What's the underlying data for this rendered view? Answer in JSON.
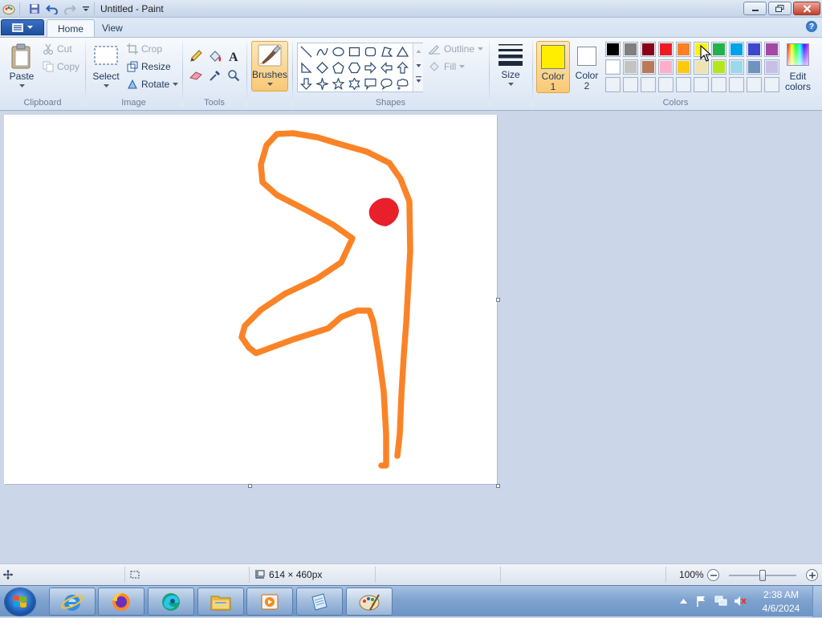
{
  "window": {
    "title": "Untitled - Paint"
  },
  "tabs": [
    {
      "label": "Home"
    },
    {
      "label": "View"
    }
  ],
  "ribbon": {
    "clipboard": {
      "group_label": "Clipboard",
      "paste": "Paste",
      "cut": "Cut",
      "copy": "Copy"
    },
    "image": {
      "group_label": "Image",
      "select": "Select",
      "crop": "Crop",
      "resize": "Resize",
      "rotate": "Rotate"
    },
    "tools": {
      "group_label": "Tools"
    },
    "brushes": {
      "label": "Brushes"
    },
    "shapes": {
      "group_label": "Shapes",
      "outline": "Outline",
      "fill": "Fill"
    },
    "size": {
      "label": "Size"
    },
    "colors": {
      "group_label": "Colors",
      "color1_label": "Color 1",
      "color1_line1": "Color",
      "color1_line2": "1",
      "color1_value": "#ffee00",
      "color2_line1": "Color",
      "color2_line2": "2",
      "color2_value": "#ffffff",
      "edit_line1": "Edit",
      "edit_line2": "colors",
      "palette_row1": [
        "#000000",
        "#7f7f7f",
        "#880015",
        "#ed1c24",
        "#ff7f27",
        "#fff200",
        "#22b14c",
        "#00a2e8",
        "#3f48cc",
        "#a349a4"
      ],
      "palette_row2": [
        "#ffffff",
        "#c3c3c3",
        "#b97a57",
        "#ffaec9",
        "#ffc90e",
        "#efe4b0",
        "#b5e61d",
        "#99d9ea",
        "#7092be",
        "#c8bfe7"
      ],
      "palette_row3": [
        "",
        "",
        "",
        "",
        "",
        "",
        "",
        "",
        "",
        ""
      ]
    }
  },
  "canvas": {
    "background": "#ffffff",
    "stroke_color": "#fb8327",
    "blob_color": "#e8202a"
  },
  "statusbar": {
    "dimensions": "614 × 460px",
    "zoom": "100%",
    "zoom_level": 1.0
  },
  "taskbar": {
    "time": "2:38 AM",
    "date": "4/6/2024",
    "apps": [
      "internet-explorer",
      "firefox",
      "edge",
      "file-explorer",
      "media-player",
      "notepad",
      "paint"
    ]
  }
}
